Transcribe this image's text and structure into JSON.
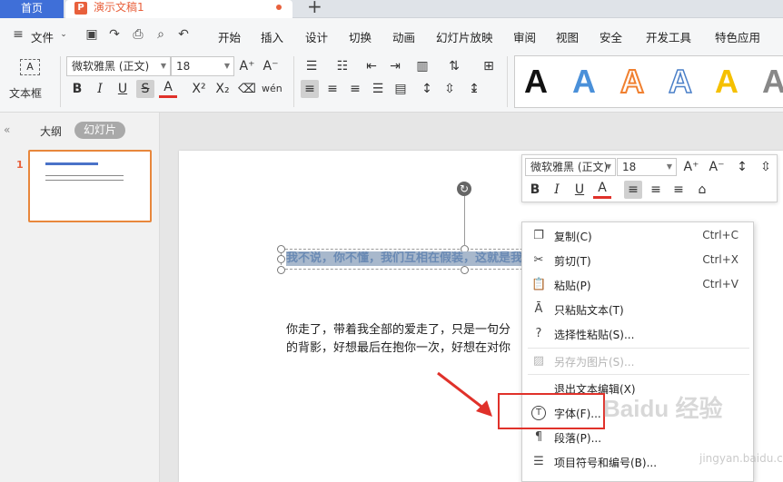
{
  "tabs": {
    "home": "首页",
    "doc": "演示文稿1",
    "add": "+"
  },
  "menu": {
    "file": "文件",
    "items": [
      "开始",
      "插入",
      "设计",
      "切换",
      "动画",
      "幻灯片放映",
      "审阅",
      "视图",
      "安全",
      "开发工具",
      "特色应用"
    ]
  },
  "ribbon": {
    "textbox_label": "文本框",
    "font_name": "微软雅黑 (正文)",
    "font_size": "18",
    "gallery": [
      {
        "letter": "A",
        "style": "black"
      },
      {
        "letter": "A",
        "style": "blue"
      },
      {
        "letter": "A",
        "style": "orange-outline"
      },
      {
        "letter": "A",
        "style": "blue-outline"
      },
      {
        "letter": "A",
        "style": "yellow"
      },
      {
        "letter": "A",
        "style": "gray"
      }
    ],
    "colors": {
      "accent": "#3f6fd8",
      "doc": "#e8603c",
      "font_red": "#e0312a"
    }
  },
  "leftpane": {
    "outline_tab": "大纲",
    "slides_tab": "幻灯片",
    "slide_number": "1"
  },
  "slide": {
    "title": "我不说，你不懂，我们互相在假装，这就是我们的距离",
    "body_line1": "你走了，带着我全部的爱走了，只是一句分",
    "body_line2": "的背影，好想最后在抱你一次，好想在对你"
  },
  "mini_toolbar": {
    "font_name": "微软雅黑 (正文)",
    "font_size": "18"
  },
  "context_menu": [
    {
      "label": "复制(C)",
      "shortcut": "Ctrl+C",
      "icon": "copy-icon",
      "disabled": false
    },
    {
      "label": "剪切(T)",
      "shortcut": "Ctrl+X",
      "icon": "scissors-icon",
      "disabled": false
    },
    {
      "label": "粘贴(P)",
      "shortcut": "Ctrl+V",
      "icon": "paste-icon",
      "disabled": false
    },
    {
      "label": "只粘贴文本(T)",
      "shortcut": "",
      "icon": "paste-text-icon",
      "disabled": false
    },
    {
      "label": "选择性粘贴(S)...",
      "shortcut": "",
      "icon": "paste-special-icon",
      "disabled": false
    },
    {
      "label": "另存为图片(S)...",
      "shortcut": "",
      "icon": "image-icon",
      "disabled": true
    },
    {
      "label": "退出文本编辑(X)",
      "shortcut": "",
      "icon": "",
      "disabled": false
    },
    {
      "label": "字体(F)...",
      "shortcut": "",
      "icon": "font-icon",
      "disabled": false
    },
    {
      "label": "段落(P)...",
      "shortcut": "",
      "icon": "paragraph-icon",
      "disabled": false
    },
    {
      "label": "项目符号和编号(B)...",
      "shortcut": "",
      "icon": "bullets-icon",
      "disabled": false
    }
  ],
  "watermark": {
    "main": "Baidu 经验",
    "sub": "jingyan.baidu.com"
  }
}
